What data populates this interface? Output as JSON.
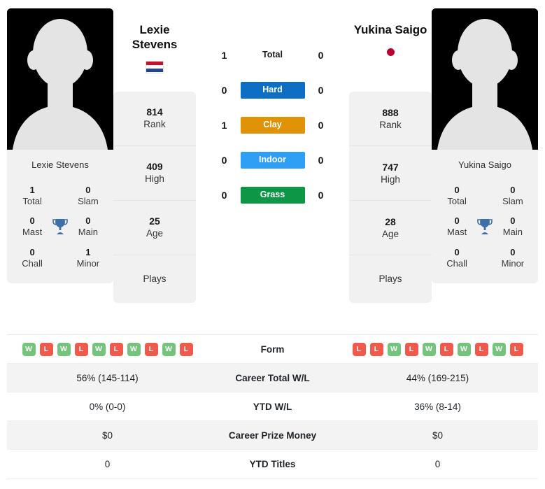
{
  "colors": {
    "win": "#74c47e",
    "loss": "#ef5a4c",
    "hard": "#0d6ec4",
    "clay": "#e09307",
    "indoor": "#2f9ff5",
    "grass": "#0e9647",
    "trophy": "#3d6fa8",
    "flag_nl_red": "#c8102e",
    "flag_nl_white": "#ffffff",
    "flag_nl_blue": "#21468b",
    "flag_jp_circle": "#bc002d"
  },
  "left_player": {
    "name": "Lexie Stevens",
    "name_line1": "Lexie",
    "name_line2": "Stevens",
    "photo_caption": "Lexie Stevens",
    "country": "Netherlands",
    "flag": "flag-netherlands",
    "titles": [
      {
        "value": "1",
        "label": "Total"
      },
      {
        "value": "0",
        "label": "Slam"
      },
      {
        "value": "0",
        "label": "Mast"
      },
      {
        "value": "0",
        "label": "Main"
      },
      {
        "value": "0",
        "label": "Chall"
      },
      {
        "value": "1",
        "label": "Minor"
      }
    ],
    "stats": [
      {
        "value": "814",
        "label": "Rank"
      },
      {
        "value": "409",
        "label": "High"
      },
      {
        "value": "25",
        "label": "Age"
      },
      {
        "value": "",
        "label": "Plays"
      }
    ],
    "form": [
      "W",
      "L",
      "W",
      "L",
      "W",
      "L",
      "W",
      "L",
      "W",
      "L"
    ],
    "career_total_wl": "56% (145-114)",
    "ytd_wl": "0% (0-0)",
    "career_prize_money": "$0",
    "ytd_titles": "0"
  },
  "right_player": {
    "name": "Yukina Saigo",
    "name_line1": "Yukina Saigo",
    "name_line2": "",
    "photo_caption": "Yukina Saigo",
    "country": "Japan",
    "flag": "flag-japan",
    "titles": [
      {
        "value": "0",
        "label": "Total"
      },
      {
        "value": "0",
        "label": "Slam"
      },
      {
        "value": "0",
        "label": "Mast"
      },
      {
        "value": "0",
        "label": "Main"
      },
      {
        "value": "0",
        "label": "Chall"
      },
      {
        "value": "0",
        "label": "Minor"
      }
    ],
    "stats": [
      {
        "value": "888",
        "label": "Rank"
      },
      {
        "value": "747",
        "label": "High"
      },
      {
        "value": "28",
        "label": "Age"
      },
      {
        "value": "",
        "label": "Plays"
      }
    ],
    "form": [
      "L",
      "L",
      "W",
      "L",
      "W",
      "L",
      "W",
      "L",
      "W",
      "L"
    ],
    "career_total_wl": "44% (169-215)",
    "ytd_wl": "36% (8-14)",
    "career_prize_money": "$0",
    "ytd_titles": "0"
  },
  "head_to_head": [
    {
      "surface": "Total",
      "left": "1",
      "right": "0",
      "styled": false
    },
    {
      "surface": "Hard",
      "left": "0",
      "right": "0",
      "styled": true
    },
    {
      "surface": "Clay",
      "left": "1",
      "right": "0",
      "styled": true
    },
    {
      "surface": "Indoor",
      "left": "0",
      "right": "0",
      "styled": true
    },
    {
      "surface": "Grass",
      "left": "0",
      "right": "0",
      "styled": true
    }
  ],
  "table": {
    "rows": [
      {
        "label": "Form"
      },
      {
        "label": "Career Total W/L"
      },
      {
        "label": "YTD W/L"
      },
      {
        "label": "Career Prize Money"
      },
      {
        "label": "YTD Titles"
      }
    ]
  }
}
